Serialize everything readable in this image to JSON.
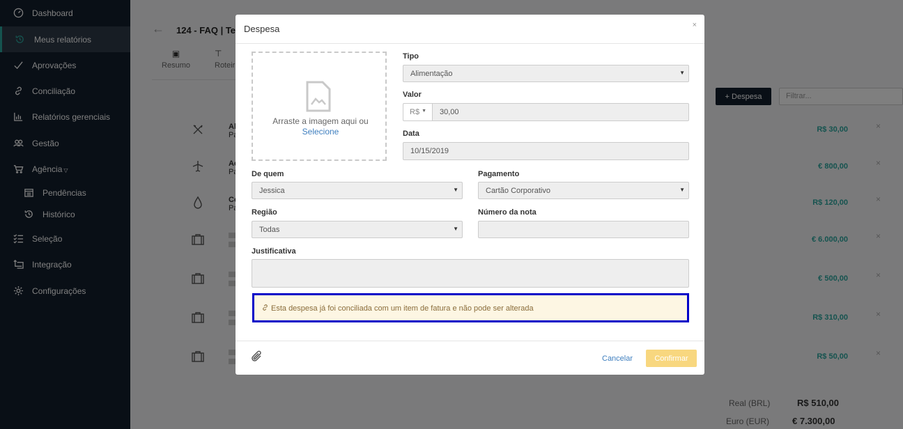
{
  "sidebar": {
    "items": [
      {
        "label": "Dashboard",
        "icon": "dashboard-icon"
      },
      {
        "label": "Meus relatórios",
        "icon": "history-icon",
        "active": true
      },
      {
        "label": "Aprovações",
        "icon": "check-icon"
      },
      {
        "label": "Conciliação",
        "icon": "link-icon"
      },
      {
        "label": "Relatórios gerenciais",
        "icon": "bar-chart-icon"
      },
      {
        "label": "Gestão",
        "icon": "users-icon"
      },
      {
        "label": "Agência",
        "icon": "cart-icon"
      },
      {
        "label": "Pendências",
        "icon": "calendar-icon"
      },
      {
        "label": "Histórico",
        "icon": "history-icon"
      },
      {
        "label": "Seleção",
        "icon": "list-check-icon"
      },
      {
        "label": "Integração",
        "icon": "integration-icon"
      },
      {
        "label": "Configurações",
        "icon": "gear-icon"
      }
    ]
  },
  "report": {
    "title": "124 - FAQ | Te",
    "tabs": [
      {
        "label": "Resumo",
        "icon": "document-icon"
      },
      {
        "label": "Roteir",
        "icon": "signpost-icon"
      }
    ],
    "add_button": "+ Despesa",
    "filter_placeholder": "Filtrar...",
    "expenses": [
      {
        "icon": "food-icon",
        "title": "Al",
        "sub": "Pa",
        "amount": "R$ 30,00"
      },
      {
        "icon": "plane-icon",
        "title": "Ac",
        "sub": "Pa",
        "amount": "€ 800,00"
      },
      {
        "icon": "fuel-icon",
        "title": "Co",
        "sub": "Pa",
        "amount": "R$ 120,00"
      },
      {
        "icon": "briefcase-icon",
        "amount": "€ 6.000,00"
      },
      {
        "icon": "briefcase-icon",
        "amount": "€ 500,00"
      },
      {
        "icon": "briefcase-icon",
        "amount": "R$ 310,00"
      },
      {
        "icon": "briefcase-icon",
        "amount": "R$ 50,00"
      }
    ],
    "totals": [
      {
        "label": "Real (BRL)",
        "value": "R$ 510,00"
      },
      {
        "label": "Euro (EUR)",
        "value": "€ 7.300,00"
      }
    ]
  },
  "modal": {
    "title": "Despesa",
    "close": "×",
    "drop_text": "Arraste a imagem aqui ou",
    "drop_link": "Selecione",
    "tipo_label": "Tipo",
    "tipo_value": "Alimentação",
    "valor_label": "Valor",
    "currency": "R$",
    "valor_value": "30,00",
    "data_label": "Data",
    "data_value": "10/15/2019",
    "dequem_label": "De quem",
    "dequem_value": "Jessica",
    "pagamento_label": "Pagamento",
    "pagamento_value": "Cartão Corporativo",
    "regiao_label": "Região",
    "regiao_value": "Todas",
    "nota_label": "Número da nota",
    "nota_value": "",
    "justificativa_label": "Justificativa",
    "justificativa_value": "",
    "notice": "Esta despesa já foi conciliada com um item de fatura e não pode ser alterada",
    "cancel": "Cancelar",
    "confirm": "Confirmar"
  },
  "colors": {
    "sidebar_bg": "#131e2c",
    "accent": "#2aa79e",
    "link": "#3f7fbf",
    "confirm": "#f8d77f",
    "highlight": "#0000c8"
  }
}
